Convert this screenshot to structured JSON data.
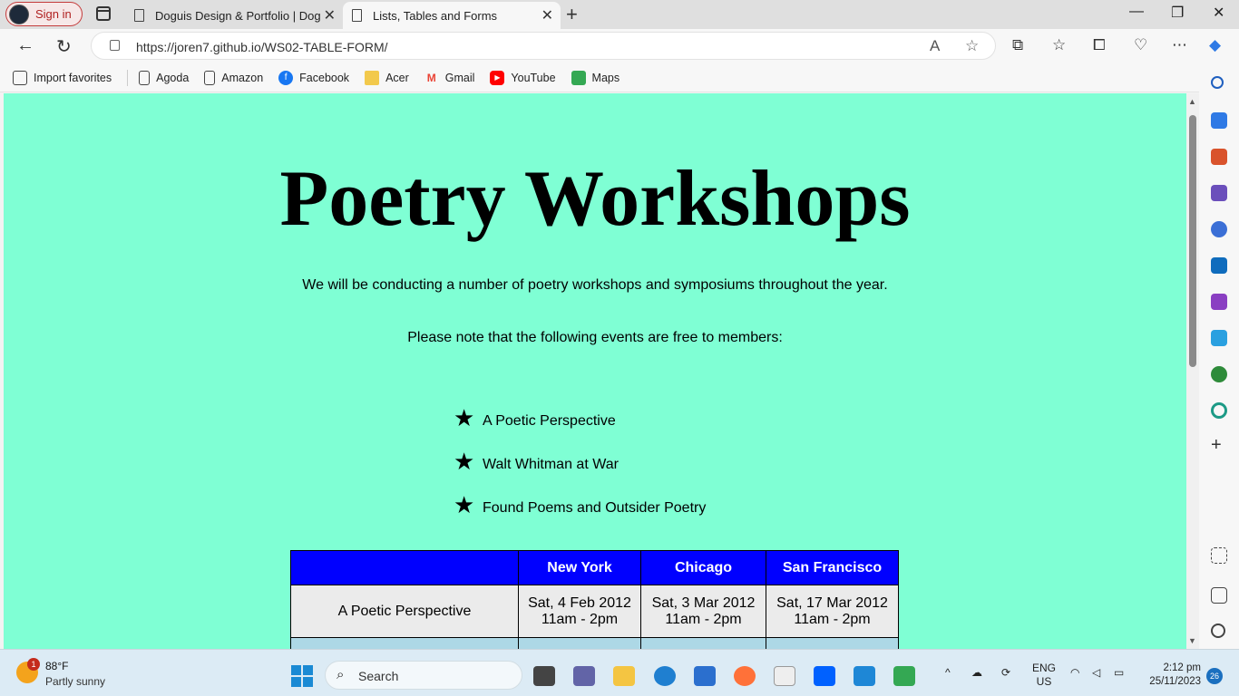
{
  "browser": {
    "signin_label": "Sign in",
    "tabs": [
      {
        "title": "Doguis Design & Portfolio | Dog"
      },
      {
        "title": "Lists, Tables and Forms"
      }
    ],
    "url": "https://joren7.github.io/WS02-TABLE-FORM/",
    "favorites": [
      {
        "label": "Import favorites",
        "icon": "import-icon"
      },
      {
        "label": "Agoda",
        "icon": "page-icon"
      },
      {
        "label": "Amazon",
        "icon": "page-icon"
      },
      {
        "label": "Facebook",
        "icon": "facebook-icon",
        "color": "#1877f2"
      },
      {
        "label": "Acer",
        "icon": "folder-icon",
        "color": "#f2c94c"
      },
      {
        "label": "Gmail",
        "icon": "gmail-icon",
        "color": "#ea4335"
      },
      {
        "label": "YouTube",
        "icon": "youtube-icon",
        "color": "#ff0000"
      },
      {
        "label": "Maps",
        "icon": "maps-icon",
        "color": "#34a853"
      }
    ]
  },
  "page": {
    "title": "Poetry Workshops",
    "intro": "We will be conducting a number of poetry workshops and symposiums throughout the year.",
    "note": "Please note that the following events are free to members:",
    "events": [
      "A Poetic Perspective",
      "Walt Whitman at War",
      "Found Poems and Outsider Poetry"
    ],
    "background": "#7fffd4",
    "table": {
      "headers": [
        "",
        "New York",
        "Chicago",
        "San Francisco"
      ],
      "rows": [
        {
          "name": "A Poetic Perspective",
          "cells": [
            {
              "date": "Sat, 4 Feb 2012",
              "time": "11am - 2pm"
            },
            {
              "date": "Sat, 3 Mar 2012",
              "time": "11am - 2pm"
            },
            {
              "date": "Sat, 17 Mar 2012",
              "time": "11am - 2pm"
            }
          ]
        }
      ],
      "header_color": "#0000ff",
      "row_colors": [
        "#ebebeb",
        "#add8e6"
      ]
    }
  },
  "taskbar": {
    "weather_badge": "1",
    "temperature": "88°F",
    "condition": "Partly sunny",
    "search_label": "Search",
    "language": "ENG",
    "region": "US",
    "time": "2:12 pm",
    "date": "25/11/2023",
    "notification_count": "26"
  }
}
